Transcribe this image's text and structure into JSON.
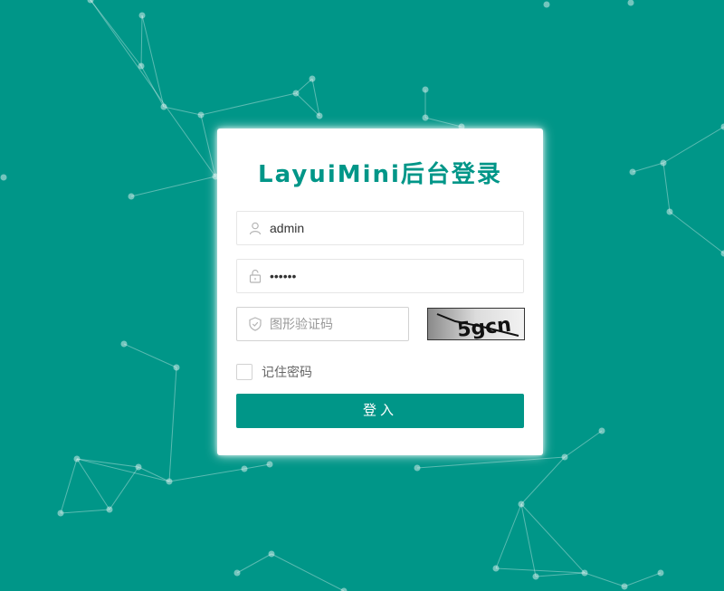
{
  "page": {
    "background_color": "#009688",
    "accent_color": "#009688"
  },
  "login": {
    "title": "LayuiMini后台登录",
    "username": {
      "value": "admin",
      "icon": "user-icon"
    },
    "password": {
      "value": "••••••",
      "icon": "lock-icon"
    },
    "captcha": {
      "placeholder": "图形验证码",
      "icon": "shield-icon",
      "image_text": "5gcn"
    },
    "remember_label": "记住密码",
    "submit_label": "登入"
  }
}
